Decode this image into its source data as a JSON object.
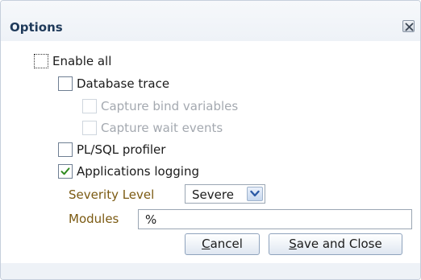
{
  "dialog": {
    "title": "Options"
  },
  "options": {
    "enable_all": {
      "label": "Enable all",
      "checked": false
    },
    "database_trace": {
      "label": "Database trace",
      "checked": false
    },
    "capture_bind_variables": {
      "label": "Capture bind variables",
      "checked": false,
      "disabled": true
    },
    "capture_wait_events": {
      "label": "Capture wait events",
      "checked": false,
      "disabled": true
    },
    "plsql_profiler": {
      "label": "PL/SQL profiler",
      "checked": false
    },
    "applications_logging": {
      "label": "Applications logging",
      "checked": true
    }
  },
  "severity": {
    "label": "Severity Level",
    "value": "Severe"
  },
  "modules": {
    "label": "Modules",
    "value": "%"
  },
  "buttons": {
    "cancel": {
      "mnemonic": "C",
      "rest": "ancel"
    },
    "save_close": {
      "mnemonic": "S",
      "rest": "ave and Close"
    }
  },
  "colors": {
    "title_text": "#1f3a5a",
    "field_label": "#7b5a12",
    "checkmark": "#2f8a1f",
    "disabled_text": "#a4a9b0"
  },
  "icons": {
    "close": "close-icon",
    "checkmark": "checkmark-icon",
    "dropdown": "chevron-down-icon"
  }
}
